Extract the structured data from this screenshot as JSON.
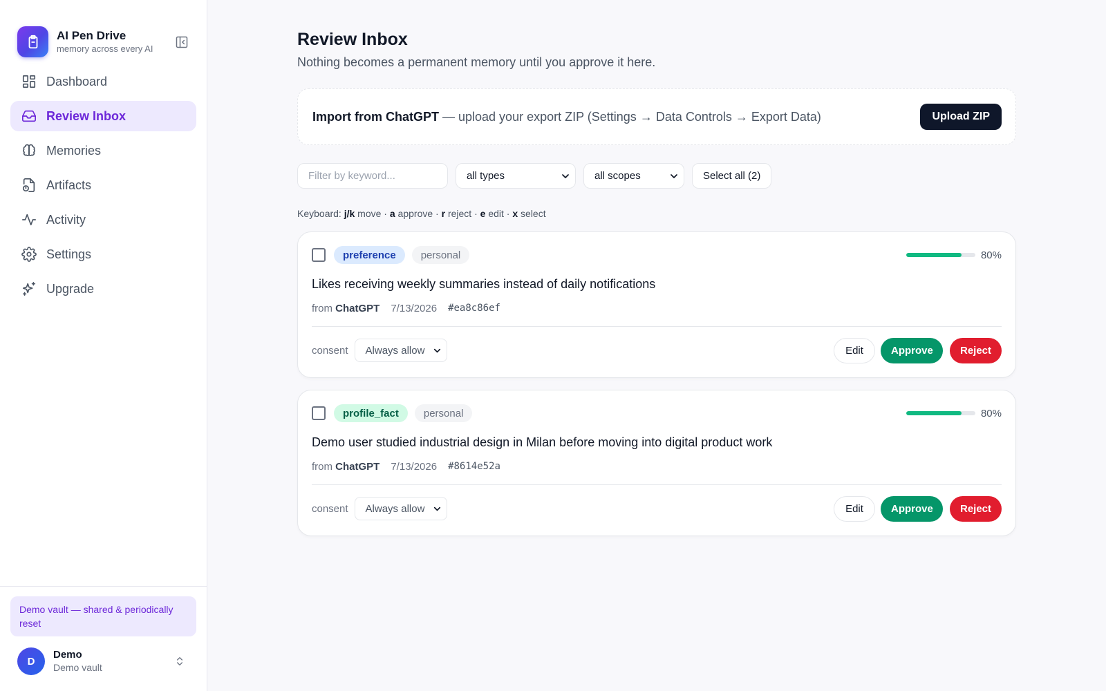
{
  "brand": {
    "title": "AI Pen Drive",
    "subtitle": "memory across every AI",
    "logo_icon": "clipboard-icon",
    "collapse_icon": "sidebar-collapse-icon"
  },
  "nav": [
    {
      "label": "Dashboard",
      "icon": "dashboard-icon",
      "active": false
    },
    {
      "label": "Review Inbox",
      "icon": "inbox-icon",
      "active": true
    },
    {
      "label": "Memories",
      "icon": "brain-icon",
      "active": false
    },
    {
      "label": "Artifacts",
      "icon": "artifact-icon",
      "active": false
    },
    {
      "label": "Activity",
      "icon": "activity-icon",
      "active": false
    },
    {
      "label": "Settings",
      "icon": "gear-icon",
      "active": false
    },
    {
      "label": "Upgrade",
      "icon": "sparkles-icon",
      "active": false
    }
  ],
  "demo_note": "Demo vault — shared & periodically reset",
  "user": {
    "initial": "D",
    "name": "Demo",
    "vault": "Demo vault"
  },
  "page": {
    "title": "Review Inbox",
    "subtitle": "Nothing becomes a permanent memory until you approve it here."
  },
  "import": {
    "title": "Import from ChatGPT",
    "description": " — upload your export ZIP (Settings → Data Controls → Export Data)",
    "button": "Upload ZIP"
  },
  "filters": {
    "keyword_placeholder": "Filter by keyword...",
    "type_value": "all types",
    "scope_value": "all scopes",
    "select_all": "Select all (2)"
  },
  "keyboard_hint": {
    "prefix": "Keyboard: ",
    "k1": "j/k",
    "t1": " move · ",
    "k2": "a",
    "t2": " approve · ",
    "k3": "r",
    "t3": " reject · ",
    "k4": "e",
    "t4": " edit · ",
    "k5": "x",
    "t5": " select"
  },
  "colors": {
    "accent": "#6d28d9",
    "approve": "#059669",
    "reject": "#e11d2e",
    "confidence": "#10b981"
  },
  "items": [
    {
      "type": "preference",
      "scope": "personal",
      "confidence": 0.8,
      "confidence_label": "80%",
      "text": "Likes receiving weekly summaries instead of daily notifications",
      "from_prefix": "from ",
      "source": "ChatGPT",
      "date": "7/13/2026",
      "hash": "#ea8c86ef",
      "consent_label": "consent",
      "consent_value": "Always allow",
      "edit": "Edit",
      "approve": "Approve",
      "reject": "Reject"
    },
    {
      "type": "profile_fact",
      "scope": "personal",
      "confidence": 0.8,
      "confidence_label": "80%",
      "text": "Demo user studied industrial design in Milan before moving into digital product work",
      "from_prefix": "from ",
      "source": "ChatGPT",
      "date": "7/13/2026",
      "hash": "#8614e52a",
      "consent_label": "consent",
      "consent_value": "Always allow",
      "edit": "Edit",
      "approve": "Approve",
      "reject": "Reject"
    }
  ]
}
